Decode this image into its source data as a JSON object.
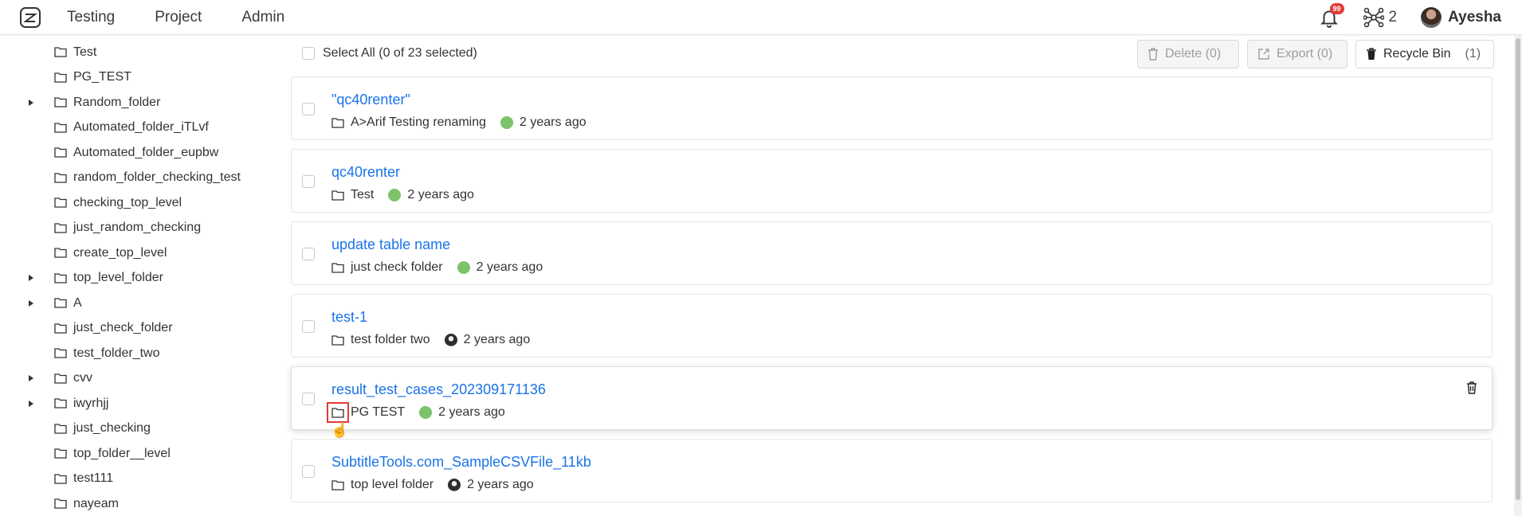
{
  "nav": {
    "items": [
      "Testing",
      "Project",
      "Admin"
    ]
  },
  "header": {
    "notification_count": "99",
    "network_count": "2",
    "user_name": "Ayesha"
  },
  "sidebar": {
    "items": [
      {
        "label": "Test",
        "expandable": false
      },
      {
        "label": "PG_TEST",
        "expandable": false
      },
      {
        "label": "Random_folder",
        "expandable": true
      },
      {
        "label": "Automated_folder_iTLvf",
        "expandable": false
      },
      {
        "label": "Automated_folder_eupbw",
        "expandable": false
      },
      {
        "label": "random_folder_checking_test",
        "expandable": false
      },
      {
        "label": "checking_top_level",
        "expandable": false
      },
      {
        "label": "just_random_checking",
        "expandable": false
      },
      {
        "label": "create_top_level",
        "expandable": false
      },
      {
        "label": "top_level_folder",
        "expandable": true
      },
      {
        "label": "A",
        "expandable": true
      },
      {
        "label": "just_check_folder",
        "expandable": false
      },
      {
        "label": "test_folder_two",
        "expandable": false
      },
      {
        "label": "cvv",
        "expandable": true
      },
      {
        "label": "iwyrhjj",
        "expandable": true
      },
      {
        "label": "just_checking",
        "expandable": false
      },
      {
        "label": "top_folder__level",
        "expandable": false
      },
      {
        "label": "test111",
        "expandable": false
      },
      {
        "label": "nayeam",
        "expandable": false
      }
    ]
  },
  "toolbar": {
    "select_all_label": "Select All (0 of 23 selected)",
    "delete_label": "Delete (0)",
    "export_label": "Export (0)",
    "recycle_label": "Recycle Bin",
    "recycle_count": "(1)"
  },
  "cards": [
    {
      "title": "\"qc40renter\"",
      "folder": "A>Arif Testing renaming",
      "time": "2 years ago",
      "owner": "green"
    },
    {
      "title": "qc40renter",
      "folder": "Test",
      "time": "2 years ago",
      "owner": "green"
    },
    {
      "title": "update table name",
      "folder": "just check folder",
      "time": "2 years ago",
      "owner": "green"
    },
    {
      "title": "test-1",
      "folder": "test folder two",
      "time": "2 years ago",
      "owner": "photo"
    },
    {
      "title": "result_test_cases_202309171136",
      "folder": "PG TEST",
      "time": "2 years ago",
      "owner": "green"
    },
    {
      "title": "SubtitleTools.com_SampleCSVFile_11kb",
      "folder": "top level folder",
      "time": "2 years ago",
      "owner": "photo"
    }
  ],
  "colors": {
    "link": "#1a73e8",
    "badge": "#e53935",
    "avatar_green": "#7cc36b",
    "highlight": "#e53935"
  }
}
